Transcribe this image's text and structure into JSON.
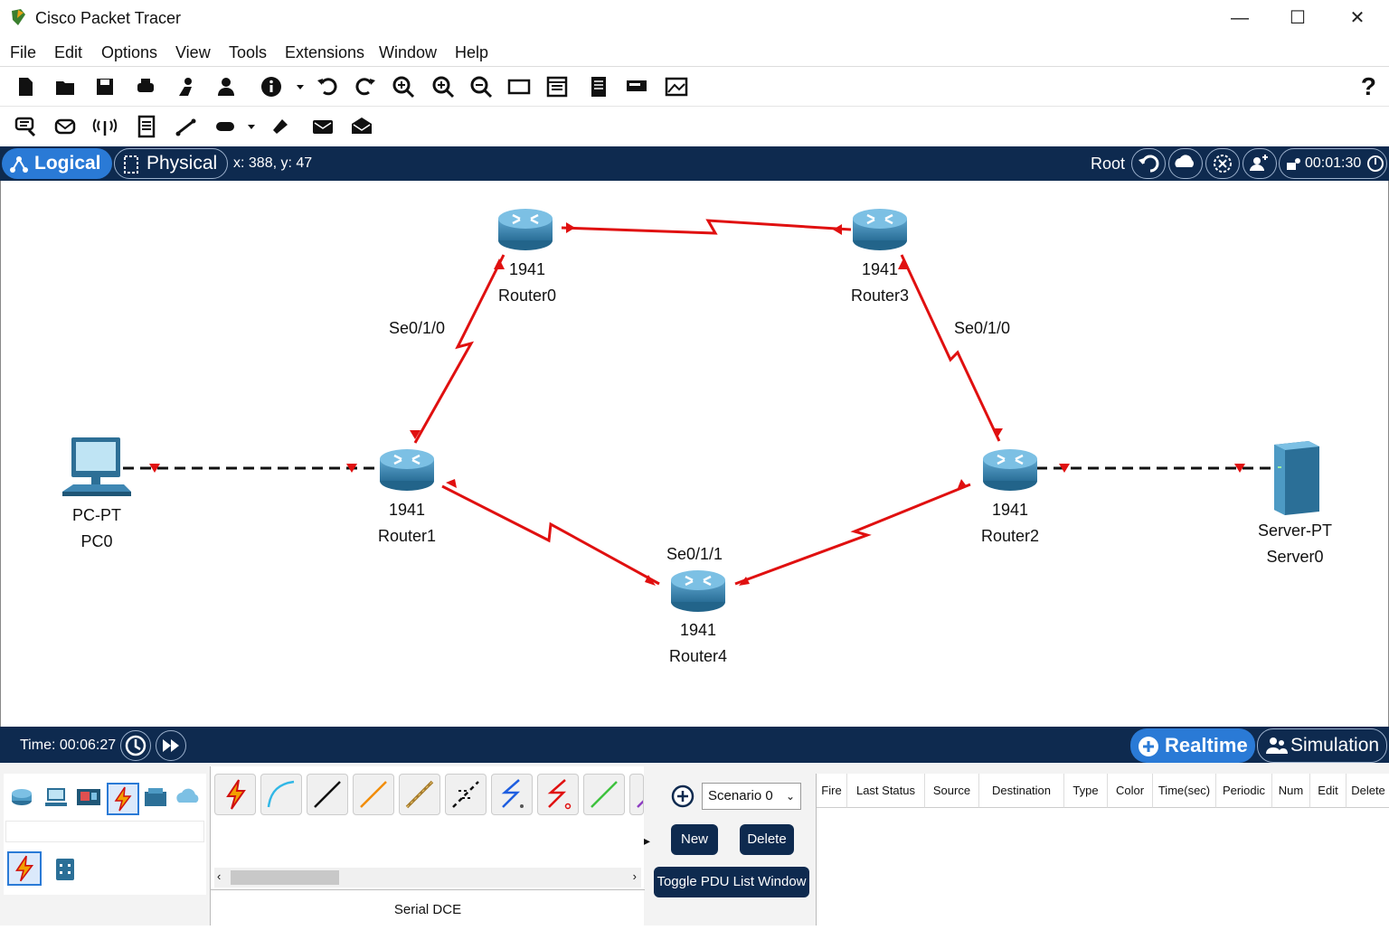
{
  "app": {
    "title": "Cisco Packet Tracer"
  },
  "menu": [
    "File",
    "Edit",
    "Options",
    "View",
    "Tools",
    "Extensions",
    "Window",
    "Help"
  ],
  "toolbar": {
    "help_label": "?"
  },
  "workspace": {
    "logical_tab": "Logical",
    "physical_tab": "Physical",
    "coords": "x: 388, y: 47",
    "root_label": "Root",
    "clock": "00:01:30"
  },
  "devices": [
    {
      "id": "pc0",
      "model": "PC-PT",
      "name": "PC0"
    },
    {
      "id": "router1",
      "model": "1941",
      "name": "Router1"
    },
    {
      "id": "router0",
      "model": "1941",
      "name": "Router0"
    },
    {
      "id": "router3",
      "model": "1941",
      "name": "Router3"
    },
    {
      "id": "router2",
      "model": "1941",
      "name": "Router2"
    },
    {
      "id": "router4",
      "model": "1941",
      "name": "Router4"
    },
    {
      "id": "server0",
      "model": "Server-PT",
      "name": "Server0"
    }
  ],
  "interface_labels": {
    "r1_r0": "Se0/1/0",
    "r3_r2": "Se0/1/0",
    "r4": "Se0/1/1"
  },
  "timebar": {
    "time": "Time: 00:06:27",
    "realtime": "Realtime",
    "simulation": "Simulation"
  },
  "bottom": {
    "selected_cable": "Serial DCE",
    "scenario": "Scenario 0",
    "new_label": "New",
    "delete_label": "Delete",
    "toggle_label": "Toggle PDU List Window",
    "columns": [
      "Fire",
      "Last Status",
      "Source",
      "Destination",
      "Type",
      "Color",
      "Time(sec)",
      "Periodic",
      "Num",
      "Edit",
      "Delete"
    ]
  },
  "colors": {
    "link_serial": "#e01010",
    "bar_bg": "#0e2a4f",
    "accent": "#2a7ad6"
  }
}
